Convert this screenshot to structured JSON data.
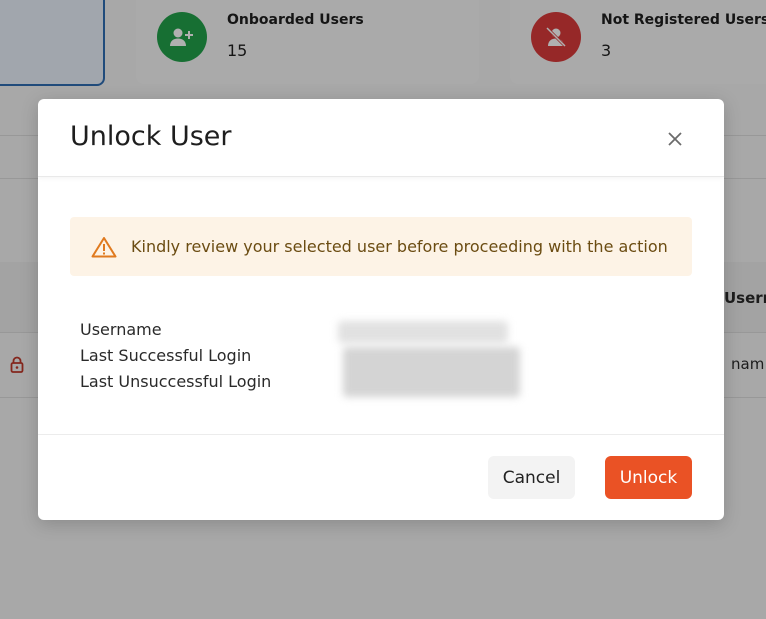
{
  "background": {
    "stats": [
      {
        "title": "Onboarded Users",
        "value": "15",
        "icon": "user-plus-icon",
        "color": "#22a14b"
      },
      {
        "title": "Not Registered Users",
        "value": "3",
        "icon": "user-off-icon",
        "color": "#d93b3b"
      }
    ],
    "table": {
      "header_partial": "Userna",
      "cell_partial": "nam"
    }
  },
  "modal": {
    "title": "Unlock User",
    "close_icon": "close-icon",
    "alert": {
      "icon": "warning-icon",
      "text": "Kindly review your selected user before proceeding with the action",
      "color": "#e07a1f"
    },
    "details": {
      "username_label": "Username",
      "last_success_label": "Last Successful Login",
      "last_fail_label": "Last Unsuccessful Login"
    },
    "buttons": {
      "cancel": "Cancel",
      "unlock": "Unlock"
    },
    "accent": "#ea5225"
  }
}
